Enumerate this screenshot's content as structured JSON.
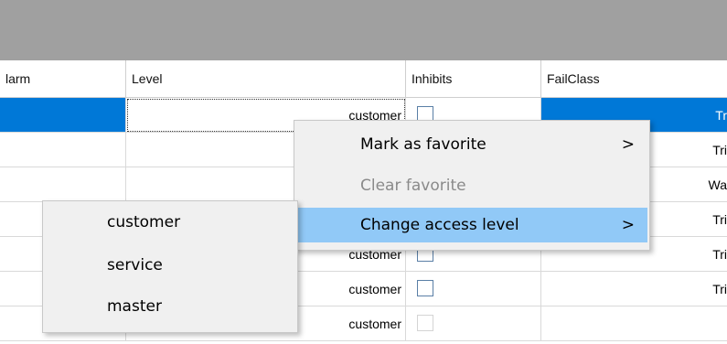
{
  "columns": {
    "alarm": "larm",
    "level": "Level",
    "inhibits": "Inhibits",
    "failclass": "FailClass"
  },
  "rows": [
    {
      "level": "customer",
      "failclass": "Tr",
      "selected": true
    },
    {
      "level": "",
      "failclass": "Tri"
    },
    {
      "level": "",
      "failclass": "Wa"
    },
    {
      "level": "",
      "failclass": "Tri"
    },
    {
      "level": "customer",
      "failclass": "Tri"
    },
    {
      "level": "customer",
      "failclass": "Tri"
    },
    {
      "level": "customer",
      "failclass": ""
    }
  ],
  "context_menu": {
    "items": [
      {
        "label": "Mark as favorite",
        "submenu": true,
        "arrow": ">"
      },
      {
        "label": "Clear favorite",
        "disabled": true
      },
      {
        "label": "Change access level",
        "submenu": true,
        "highlighted": true,
        "arrow": ">"
      }
    ]
  },
  "access_submenu": {
    "items": [
      "customer",
      "service",
      "master"
    ]
  },
  "colors": {
    "selection": "#0078d7",
    "menu_highlight": "#91c9f7",
    "menu_bg": "#f0f0f0",
    "topbar": "#a0a0a0"
  }
}
